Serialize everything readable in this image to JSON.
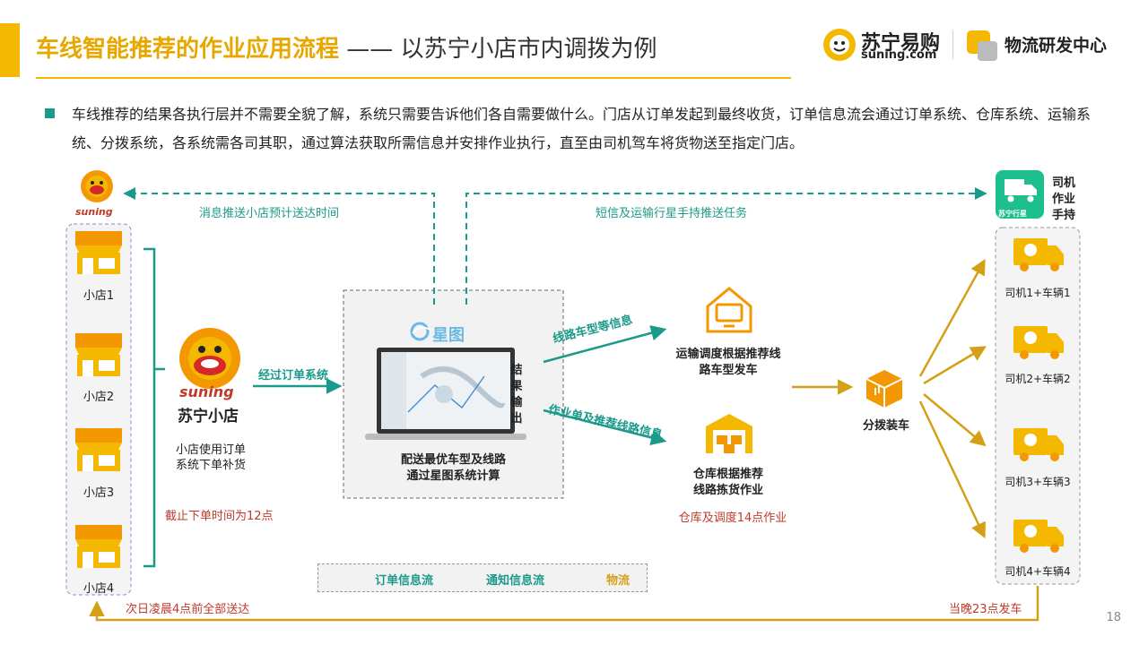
{
  "header": {
    "title_main": "车线智能推荐的作业应用流程",
    "title_sub": " —— 以苏宁小店市内调拨为例",
    "brand_cn": "苏宁易购",
    "brand_en": "suning.com",
    "dept": "物流研发中心"
  },
  "intro": "车线推荐的结果各执行层并不需要全貌了解，系统只需要告诉他们各自需要做什么。门店从订单发起到最终收货，订单信息流会通过订单系统、仓库系统、运输系统、分拨系统，各系统需各司其职，通过算法获取所需信息并安排作业执行，直至由司机驾车将货物送至指定门店。",
  "stores": {
    "logo_text": "suning",
    "items": [
      "小店1",
      "小店2",
      "小店3",
      "小店4"
    ]
  },
  "mascot": {
    "logo_text": "suning",
    "name": "苏宁小店",
    "desc_line1": "小店使用订单",
    "desc_line2": "系统下单补货",
    "cutoff": "截止下单时间为12点"
  },
  "flows": {
    "via_order": "经过订单系统",
    "notify_store": "消息推送小店预计送达时间",
    "notify_driver": "短信及运输行星手持推送任务",
    "route_info": "线路车型等信息",
    "order_route_info": "作业单及推荐线路信息",
    "deliver_all": "次日凌晨4点前全部送达",
    "depart": "当晚23点发车"
  },
  "system": {
    "brand": "星图",
    "output": "结果输出",
    "desc_line1": "配送最优车型及线路",
    "desc_line2": "通过星图系统计算"
  },
  "transport": {
    "line1": "运输调度根据推荐线",
    "line2": "路车型发车"
  },
  "warehouse": {
    "line1": "仓库根据推荐",
    "line2": "线路拣货作业",
    "note": "仓库及调度14点作业"
  },
  "sorting": {
    "label": "分拨装车"
  },
  "handheld": {
    "app_label": "苏宁行星",
    "label_line1": "司机",
    "label_line2": "作业",
    "label_line3": "手持"
  },
  "drivers": [
    "司机1+车辆1",
    "司机2+车辆2",
    "司机3+车辆3",
    "司机4+车辆4"
  ],
  "legend": {
    "order_flow": "订单信息流",
    "notify_flow": "通知信息流",
    "logistics": "物流"
  },
  "colors": {
    "accent": "#F5B800",
    "teal": "#1a9a8a",
    "gold": "#D4A017",
    "orange": "#F39800",
    "red": "#c0392b"
  },
  "page_number": "18"
}
